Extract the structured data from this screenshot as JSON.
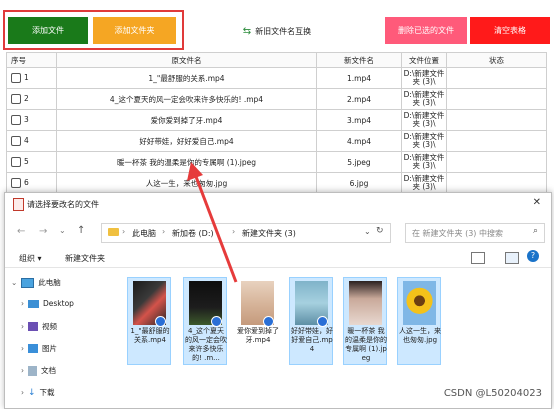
{
  "toolbar": {
    "add_file": "添加文件",
    "add_folder": "添加文件夹",
    "swap_names": "新旧文件名互换",
    "delete_selected": "删除已选的文件",
    "clear_table": "清空表格"
  },
  "colors": {
    "add_file": "#1a7a1a",
    "add_folder": "#f5a623",
    "delete_selected": "#ff5a7a",
    "clear_table": "#ff1a1a",
    "highlight": "#e03a3a",
    "selection": "#cde8ff"
  },
  "table": {
    "headers": [
      "序号",
      "原文件名",
      "新文件名",
      "文件位置",
      "状态"
    ],
    "rows": [
      {
        "no": "1",
        "orig": "1_\"最舒服的关系.mp4",
        "new": "1.mp4",
        "loc": "D:\\新建文件夹 (3)\\"
      },
      {
        "no": "2",
        "orig": "4_这个夏天的风一定会吹来许多快乐的! .mp4",
        "new": "2.mp4",
        "loc": "D:\\新建文件夹 (3)\\"
      },
      {
        "no": "3",
        "orig": "爱你爱到掉了牙.mp4",
        "new": "3.mp4",
        "loc": "D:\\新建文件夹 (3)\\"
      },
      {
        "no": "4",
        "orig": "好好带娃，好好爱自己.mp4",
        "new": "4.mp4",
        "loc": "D:\\新建文件夹 (3)\\"
      },
      {
        "no": "5",
        "orig": "暖一杯茶 我的温柔是你的专属啊 (1).jpeg",
        "new": "5.jpeg",
        "loc": "D:\\新建文件夹 (3)\\"
      },
      {
        "no": "6",
        "orig": "人这一生，来也匆匆.jpg",
        "new": "6.jpg",
        "loc": "D:\\新建文件夹 (3)\\"
      }
    ]
  },
  "dialog": {
    "title": "请选择要改名的文件",
    "breadcrumb": [
      "此电脑",
      "新加卷 (D:)",
      "新建文件夹 (3)"
    ],
    "search_placeholder": "在 新建文件夹 (3) 中搜索",
    "organize": "组织 ▾",
    "new_folder": "新建文件夹",
    "sidebar": [
      "此电脑",
      "Desktop",
      "视频",
      "图片",
      "文档",
      "下载"
    ],
    "files": [
      {
        "name": "1_\"最舒服的关系.mp4"
      },
      {
        "name": "4_这个夏天的风一定会吹来许多快乐的! .m..."
      },
      {
        "name": "爱你爱到掉了牙.mp4"
      },
      {
        "name": "好好带娃，好好爱自己.mp4"
      },
      {
        "name": "暖一杯茶 我的温柔是你的专属啊 (1).jpeg"
      },
      {
        "name": "人这一生，来也匆匆.jpg"
      }
    ]
  },
  "watermark": "CSDN @L50204023"
}
